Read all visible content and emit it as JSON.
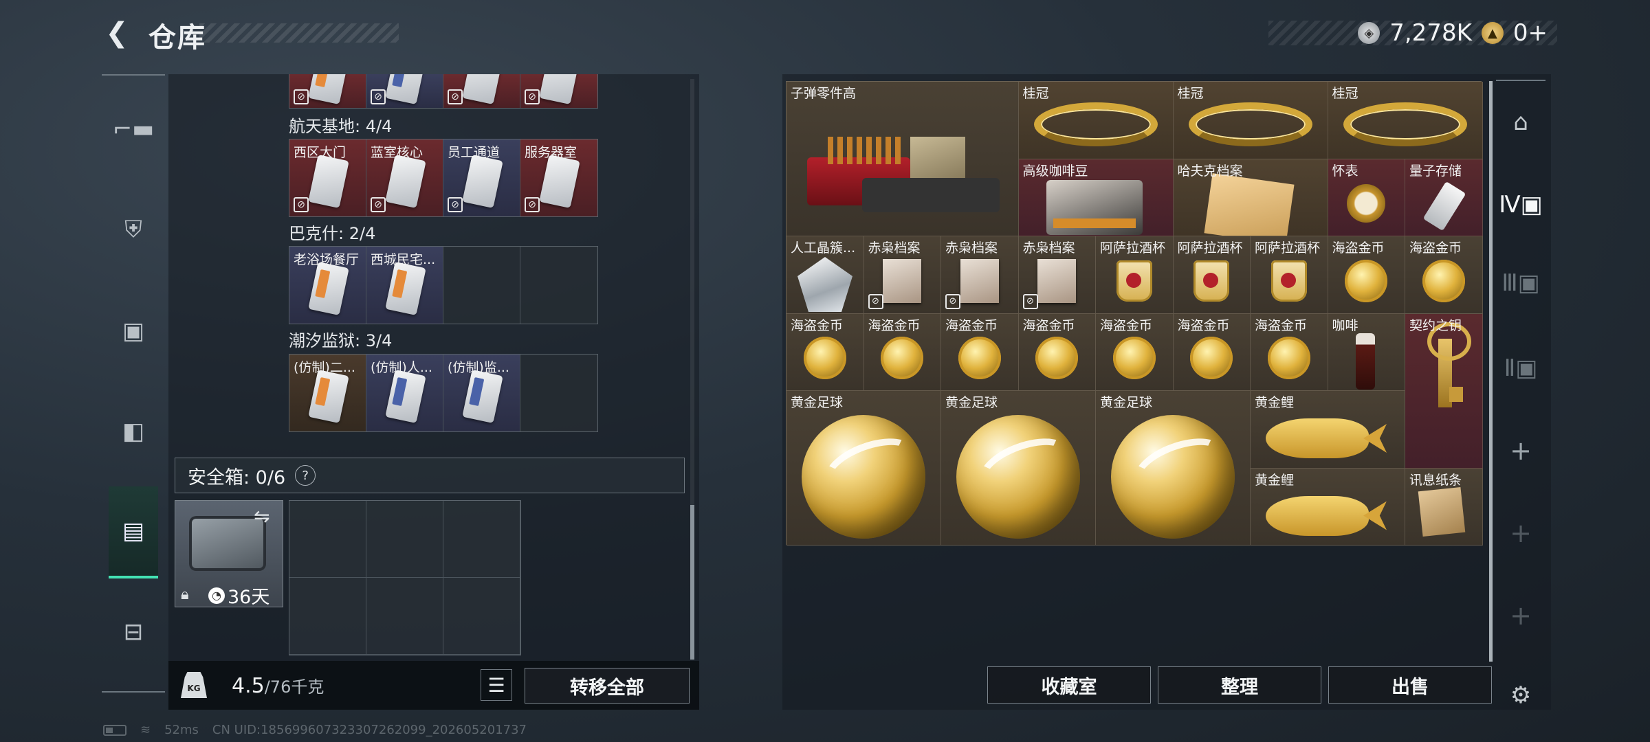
{
  "header": {
    "title": "仓库",
    "currency_silver": "7,278K",
    "currency_gold": "0+"
  },
  "left_rail": {
    "items": [
      {
        "name": "weapons",
        "icon": "pistol-icon"
      },
      {
        "name": "armor",
        "icon": "vest-icon"
      },
      {
        "name": "backpack",
        "icon": "backpack-icon"
      },
      {
        "name": "chest-rig",
        "icon": "rig-icon"
      },
      {
        "name": "safe-box",
        "icon": "safe-case-icon",
        "active": true
      },
      {
        "name": "toolbox",
        "icon": "briefcase-icon"
      }
    ]
  },
  "key_sections": [
    {
      "title": "",
      "cells": [
        {
          "label": ""
        },
        {
          "label": ""
        },
        {
          "label": ""
        },
        {
          "label": ""
        }
      ]
    },
    {
      "title": "航天基地: 4/4",
      "cells": [
        {
          "label": "西区大门"
        },
        {
          "label": "蓝室核心"
        },
        {
          "label": "员工通道"
        },
        {
          "label": "服务器室"
        }
      ]
    },
    {
      "title": "巴克什: 2/4",
      "cells": [
        {
          "label": "老浴场餐厅"
        },
        {
          "label": "西城民宅..."
        },
        {
          "label": ""
        },
        {
          "label": ""
        }
      ]
    },
    {
      "title": "潮汐监狱: 3/4",
      "cells": [
        {
          "label": "(仿制)二..."
        },
        {
          "label": "(仿制)人..."
        },
        {
          "label": "(仿制)监..."
        },
        {
          "label": ""
        }
      ]
    }
  ],
  "safe_box": {
    "label": "安全箱: 0/6",
    "help": "?",
    "timer": "36天"
  },
  "bottom_left": {
    "weight_current": "4.5",
    "weight_capacity": "/76千克",
    "weight_icon_text": "KG",
    "transfer_all": "转移全部"
  },
  "items": [
    {
      "label": "子弹零件高",
      "art": "ammo"
    },
    {
      "label": "桂冠",
      "art": "crown"
    },
    {
      "label": "桂冠",
      "art": "crown"
    },
    {
      "label": "桂冠",
      "art": "crown"
    },
    {
      "label": "高级咖啡豆",
      "art": "coffee"
    },
    {
      "label": "哈夫克档案",
      "art": "dossier"
    },
    {
      "label": "怀表",
      "art": "watch"
    },
    {
      "label": "量子存储",
      "art": "usb"
    },
    {
      "label": "人工晶簇...",
      "art": "diamond"
    },
    {
      "label": "赤枭档案",
      "art": "photo"
    },
    {
      "label": "赤枭档案",
      "art": "photo"
    },
    {
      "label": "赤枭档案",
      "art": "photo"
    },
    {
      "label": "阿萨拉酒杯",
      "art": "cup"
    },
    {
      "label": "阿萨拉酒杯",
      "art": "cup"
    },
    {
      "label": "阿萨拉酒杯",
      "art": "cup"
    },
    {
      "label": "海盗金币",
      "art": "coin"
    },
    {
      "label": "海盗金币",
      "art": "coin"
    },
    {
      "label": "海盗金币",
      "art": "coin"
    },
    {
      "label": "海盗金币",
      "art": "coin"
    },
    {
      "label": "海盗金币",
      "art": "coin"
    },
    {
      "label": "海盗金币",
      "art": "coin"
    },
    {
      "label": "海盗金币",
      "art": "coin"
    },
    {
      "label": "海盗金币",
      "art": "coin"
    },
    {
      "label": "海盗金币",
      "art": "coin"
    },
    {
      "label": "咖啡",
      "art": "bottle"
    },
    {
      "label": "契约之钥",
      "art": "key"
    },
    {
      "label": "黄金足球",
      "art": "ball"
    },
    {
      "label": "黄金足球",
      "art": "ball"
    },
    {
      "label": "黄金足球",
      "art": "ball"
    },
    {
      "label": "黄金鲤",
      "art": "fish"
    },
    {
      "label": "黄金鲤",
      "art": "fish"
    },
    {
      "label": "讯息纸条",
      "art": "note"
    }
  ],
  "right_rail": {
    "items": [
      {
        "name": "stash-tab-1",
        "icon": "vault-icon"
      },
      {
        "name": "stash-tab-4",
        "icon": "stash-IV-icon",
        "active": true
      },
      {
        "name": "stash-tab-3",
        "icon": "stash-III-icon"
      },
      {
        "name": "stash-tab-2",
        "icon": "stash-II-icon"
      },
      {
        "name": "add-tab",
        "icon": "plus-icon"
      },
      {
        "name": "add-tab-locked-1",
        "icon": "plus-icon"
      },
      {
        "name": "add-tab-locked-2",
        "icon": "plus-icon"
      },
      {
        "name": "settings",
        "icon": "gear-icon"
      }
    ]
  },
  "actions": {
    "collection": "收藏室",
    "organize": "整理",
    "sell": "出售"
  },
  "status": {
    "ping": "52ms",
    "uid": "CN UID:1856996073233072620​99_202605201737"
  }
}
